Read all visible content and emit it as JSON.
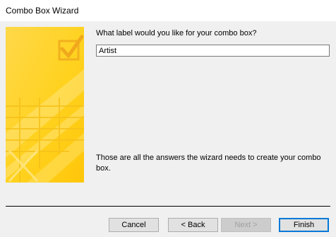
{
  "window": {
    "title": "Combo Box Wizard"
  },
  "main": {
    "prompt": "What label would you like for your combo box?",
    "label_value": "Artist",
    "finish_message": "Those are all the answers the wizard needs to create your combo box."
  },
  "buttons": {
    "cancel": "Cancel",
    "back": "< Back",
    "next": "Next >",
    "finish": "Finish"
  },
  "colors": {
    "graphic_light": "#ffe680",
    "graphic_mid": "#ffd633",
    "graphic_dark": "#f5b800"
  }
}
